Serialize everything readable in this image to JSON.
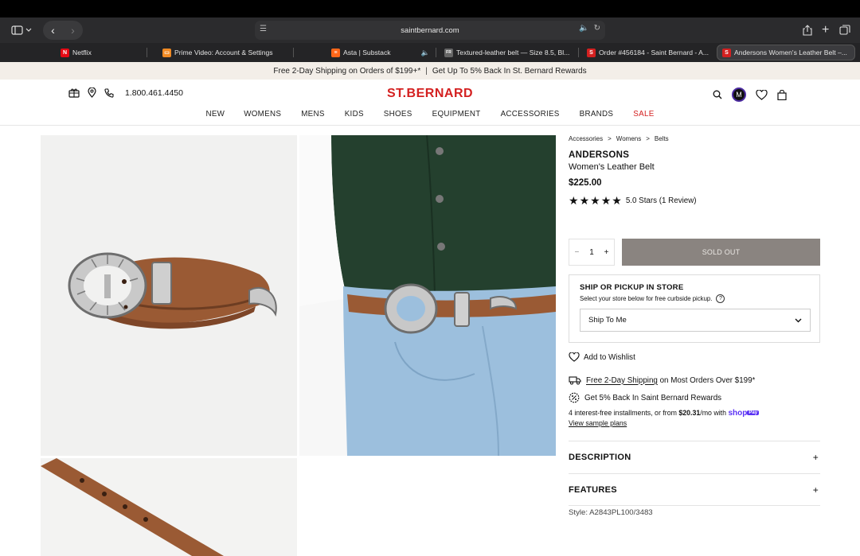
{
  "browser": {
    "url": "saintbernard.com",
    "tabs": [
      {
        "label": "Netflix",
        "favicon_color": "#e50914",
        "favicon_text": "N"
      },
      {
        "label": "Prime Video: Account & Settings",
        "favicon_color": "#f08a24",
        "favicon_text": "▭"
      },
      {
        "label": "Asta | Substack",
        "favicon_color": "#ff6719",
        "favicon_text": "≡"
      },
      {
        "label": "Textured-leather belt — Size 8.5, Bl...",
        "favicon_color": "#666",
        "favicon_text": "FR"
      },
      {
        "label": "Order #456184 - Saint Bernard - A...",
        "favicon_color": "#d42020",
        "favicon_text": "S"
      },
      {
        "label": "Andersons Women's Leather Belt –...",
        "favicon_color": "#d42020",
        "favicon_text": "S"
      }
    ]
  },
  "promo": {
    "left": "Free 2-Day Shipping on Orders of $199+*",
    "separator": "|",
    "right": "Get Up To 5% Back In St. Bernard Rewards"
  },
  "header": {
    "phone": "1.800.461.4450",
    "logo": "ST.BERNARD",
    "avatar_initial": "M",
    "nav": [
      "NEW",
      "WOMENS",
      "MENS",
      "KIDS",
      "SHOES",
      "EQUIPMENT",
      "ACCESSORIES",
      "BRANDS",
      "SALE"
    ],
    "sale_color": "#d42020"
  },
  "product": {
    "breadcrumb": [
      "Accessories",
      ">",
      "Womens",
      ">",
      "Belts"
    ],
    "brand": "ANDERSONS",
    "name": "Women's Leather Belt",
    "price": "$225.00",
    "stars": 5,
    "rating_text": "5.0 Stars (1 Review)",
    "qty_minus": "−",
    "qty": "1",
    "qty_plus": "+",
    "cta": "SOLD OUT",
    "ship_title": "SHIP OR PICKUP IN STORE",
    "ship_sub": "Select your store below for free curbside pickup.",
    "ship_help": "?",
    "ship_select": "Ship To Me",
    "wishlist": "Add to Wishlist",
    "perk1_link": "Free 2-Day Shipping",
    "perk1_rest": " on Most Orders Over $199*",
    "perk2": "Get 5% Back In Saint Bernard Rewards",
    "install_pre": "4 interest-free installments, or from ",
    "install_amount": "$20.31",
    "install_post": "/mo with",
    "shop_label": "shop",
    "pay_label": "Pay",
    "sample_link": "View sample plans",
    "description": "DESCRIPTION",
    "features": "FEATURES",
    "acc_plus": "+",
    "style": "Style: A2843PL100/3483"
  }
}
